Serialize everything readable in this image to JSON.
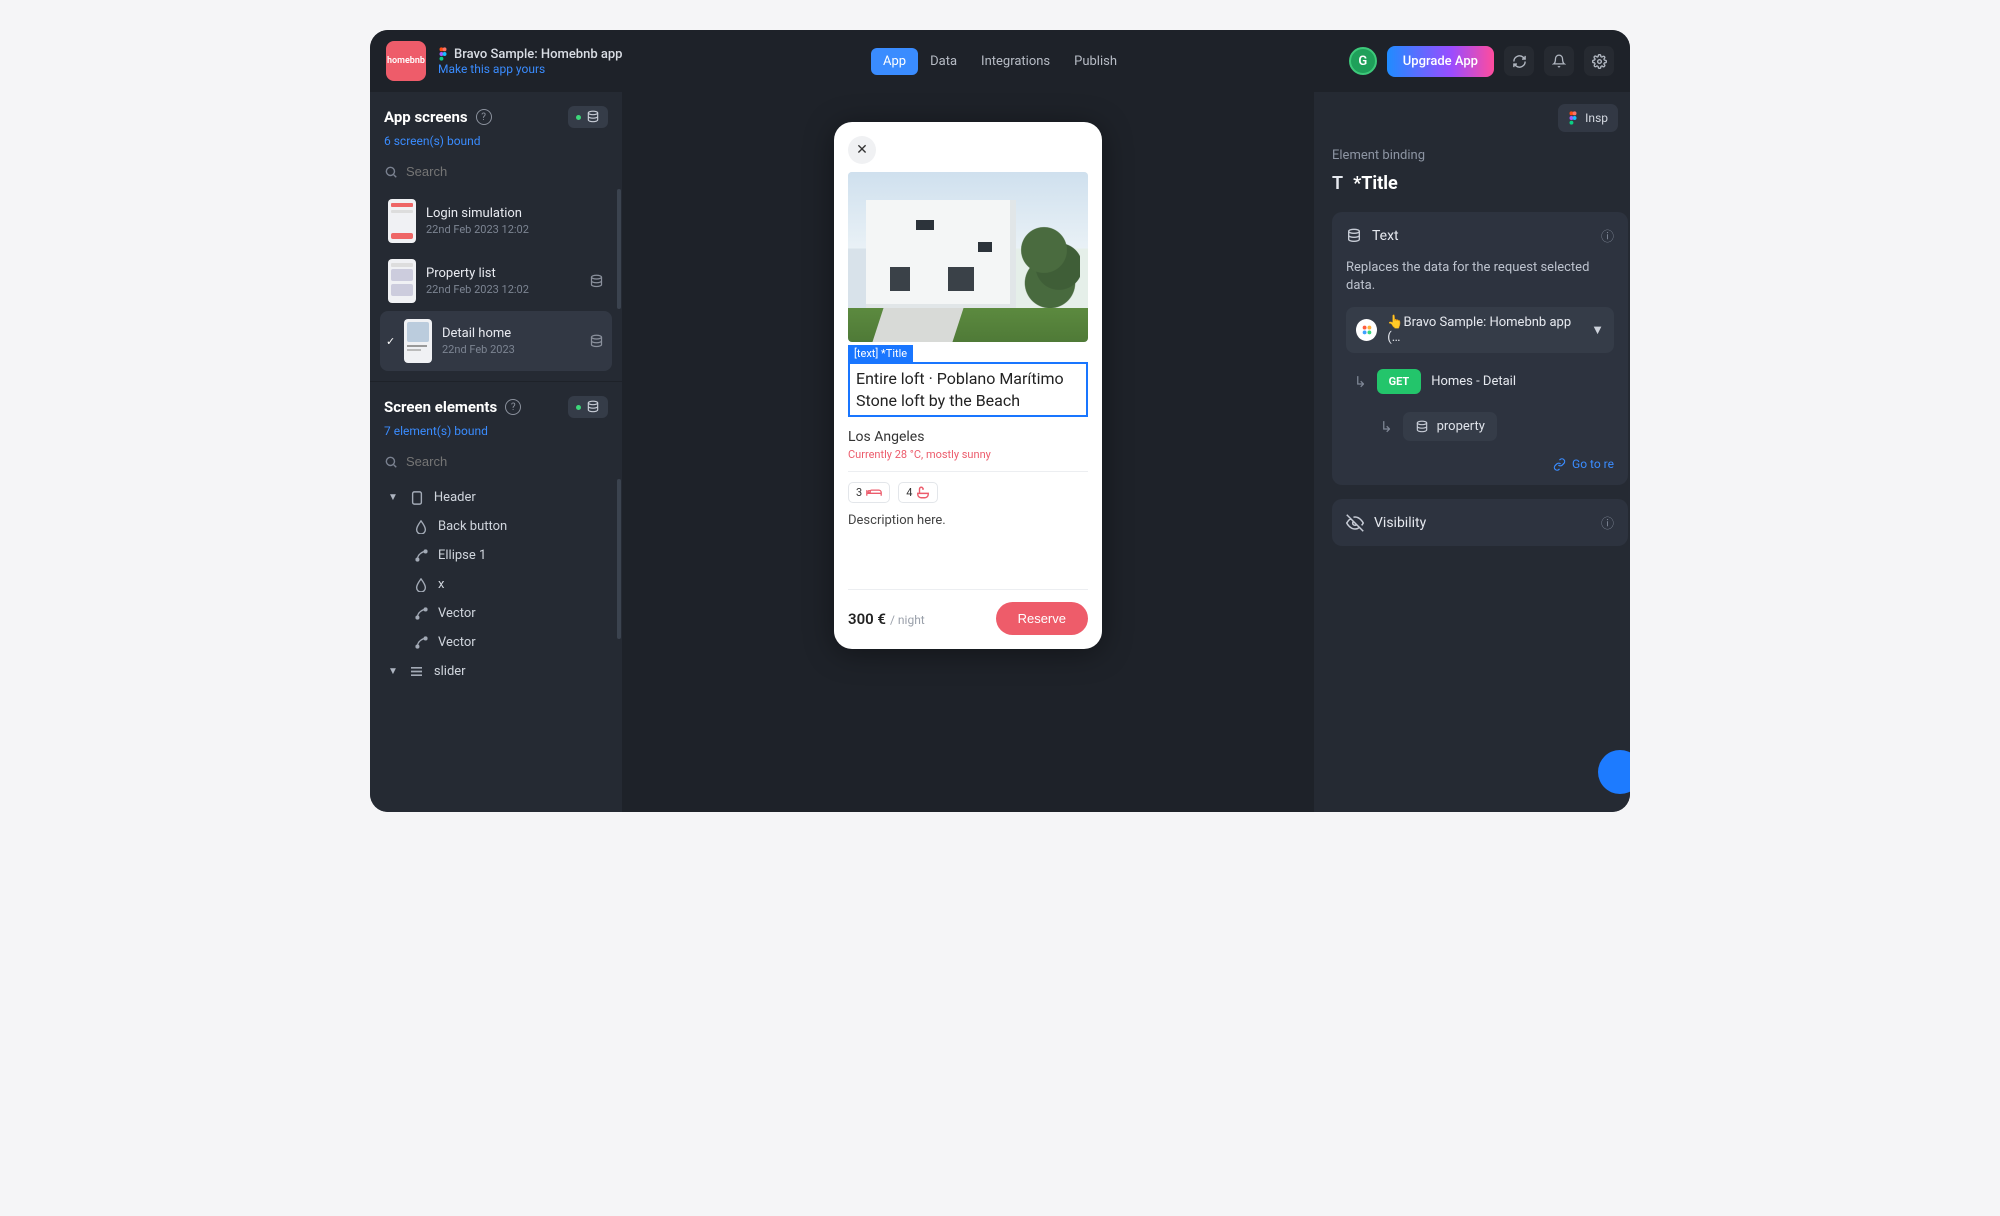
{
  "header": {
    "logo_text": "homebnb",
    "title": "Bravo Sample: Homebnb app",
    "make_yours": "Make this app yours",
    "tabs": [
      "App",
      "Data",
      "Integrations",
      "Publish"
    ],
    "active_tab": 0,
    "avatar_letter": "G",
    "upgrade": "Upgrade App",
    "inspect": "Insp"
  },
  "sidebar": {
    "screens": {
      "heading": "App screens",
      "bound_text": "6 screen(s) bound",
      "search_placeholder": "Search",
      "items": [
        {
          "name": "Login simulation",
          "date": "22nd Feb 2023 12:02",
          "has_db": false,
          "selected": false
        },
        {
          "name": "Property list",
          "date": "22nd Feb 2023 12:02",
          "has_db": true,
          "selected": false
        },
        {
          "name": "Detail home",
          "date": "22nd Feb 2023",
          "has_db": true,
          "selected": true
        }
      ]
    },
    "elements": {
      "heading": "Screen elements",
      "bound_text": "7 element(s) bound",
      "search_placeholder": "Search",
      "tree": [
        {
          "label": "Header",
          "icon": "container",
          "indent": 0,
          "expandable": true
        },
        {
          "label": "Back button",
          "icon": "drop",
          "indent": 1
        },
        {
          "label": "Ellipse 1",
          "icon": "vector",
          "indent": 1
        },
        {
          "label": "x",
          "icon": "drop",
          "indent": 1
        },
        {
          "label": "Vector",
          "icon": "vector",
          "indent": 1
        },
        {
          "label": "Vector",
          "icon": "vector",
          "indent": 1
        },
        {
          "label": "slider",
          "icon": "stack",
          "indent": 0,
          "expandable": true
        }
      ]
    }
  },
  "preview": {
    "tag": "[text] *Title",
    "title": "Entire loft · Poblano Marítimo Stone loft by the Beach",
    "city": "Los Angeles",
    "weather": "Currently 28 °C, mostly sunny",
    "beds": "3",
    "baths": "4",
    "description": "Description here.",
    "price": "300 €",
    "per_night": "/ night",
    "reserve": "Reserve"
  },
  "right": {
    "section": "Element binding",
    "element_name": "*Title",
    "text_panel": {
      "head": "Text",
      "desc": "Replaces the data for the request selected data.",
      "source": "👆Bravo Sample: Homebnb app (…",
      "method": "GET",
      "endpoint": "Homes - Detail",
      "property": "property",
      "goto": "Go to re"
    },
    "visibility": "Visibility"
  }
}
